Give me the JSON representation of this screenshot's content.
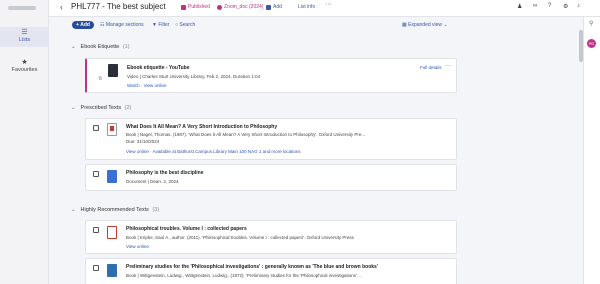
{
  "topbar": {
    "title": "PHL777 - The best subject",
    "items": [
      {
        "label": "Published",
        "color": "#c0318a"
      },
      {
        "label": "Zoom_doc (2024)",
        "color": "#c0318a"
      },
      {
        "label": "Add",
        "color": "#3b57a6"
      },
      {
        "label": "List info",
        "color": "#3b57a6"
      }
    ]
  },
  "sidebar": {
    "items": [
      {
        "label": "Lists"
      },
      {
        "label": "Favourites"
      }
    ]
  },
  "toolbar": {
    "add_label": "+ Add",
    "manage_label": "Manage sections",
    "filter_label": "Filter",
    "search_label": "Search",
    "view_label": "Expanded view ⌄"
  },
  "sections": [
    {
      "title": "Ebook Etiquette",
      "count": "(1)",
      "cards": [
        {
          "title": "Ebook etiquette - YouTube",
          "meta": "Video | Charles Sturt University Library, Feb 2, 2024, Duration 1:04",
          "links": "Watch · View online",
          "full": "Full details",
          "num": "6"
        }
      ]
    },
    {
      "title": "Prescribed Texts",
      "count": "(2)",
      "cards": [
        {
          "title": "What Does It All Mean? A Very Short Introduction to Philosophy",
          "meta": "Book | Nagel, Thomas. (1987). 'What Does It All Mean? A Very Short Introduction to Philosophy'. Oxford University Pre...",
          "meta2": "Due: 31/10/2024",
          "links": "View online · Available at Bathurst Campus Library Main 100 NAG 1 and more locations"
        },
        {
          "title": "Philosophy is the best discipline",
          "meta": "Document | Dean. 2, 2024"
        }
      ]
    },
    {
      "title": "Highly Recommended Texts",
      "count": "(3)",
      "cards": [
        {
          "title": "Philosophical troubles. Volume I : collected papers",
          "meta": "Book | Kripke, Saul A., author. (2011). 'Philosophical troubles. Volume I : collected papers'. Oxford University Press",
          "links": "View online"
        },
        {
          "title": "Preliminary studies for the 'Philosophical investigations' : generally known as 'The blue and brown books'",
          "meta": "Book | Wittgenstein, Ludwig., Wittgenstein, Ludwig., (1972). 'Preliminary studies for the 'Philosophical investigations' ..."
        }
      ]
    }
  ],
  "rail": {
    "badge": "PD"
  }
}
